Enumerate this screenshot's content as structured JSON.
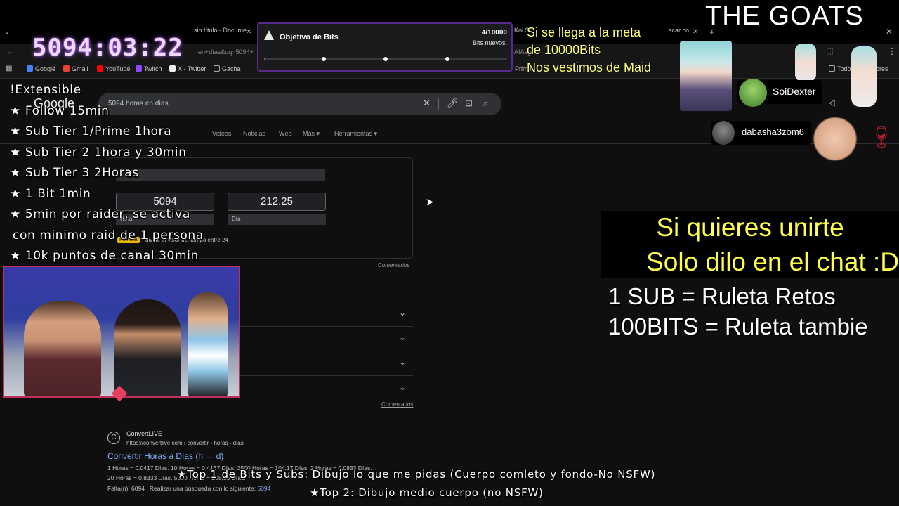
{
  "browser": {
    "tabs": [
      "sin título - Docume",
      "Objetivo de Bits"
    ],
    "tab_partials": [
      "Koi S",
      "scar co"
    ],
    "url": "en+días&oq=5094+",
    "url_right": "AIAsg",
    "bookmarks": [
      {
        "label": "Google",
        "color": "#4285f4"
      },
      {
        "label": "Gmail",
        "color": "#ea4335"
      },
      {
        "label": "YouTube",
        "color": "#ff0000"
      },
      {
        "label": "Twitch",
        "color": "#9146ff"
      },
      {
        "label": "X - Twitter",
        "color": "#ffffff"
      },
      {
        "label": "Gacha",
        "color": "#8a8a8a"
      }
    ],
    "bookmarks_right": [
      "Prime",
      "Todo",
      "dores"
    ]
  },
  "google": {
    "logo": "Google",
    "query": "5094 horas en días",
    "tabs": [
      "Videos",
      "Noticias",
      "Web",
      "Más ▾",
      "Herramientas ▾"
    ],
    "converter": {
      "left_value": "5094",
      "right_value": "212.25",
      "equals": "=",
      "left_unit": "Hora",
      "right_unit": "Día",
      "formula_badge": "Fórmula",
      "formula_text": "divide el valor de tiempo entre 24",
      "comentarios": "Comentarios"
    },
    "comentarios_2": "Comentarios",
    "result": {
      "site": "ConvertLIVE",
      "url": "https://convertlive.com › convertir › horas › días",
      "title": "Convertir Horas a Días (h → d)",
      "line1": "1 Horas = 0.0417 Días. 10 Horas = 0.4167 Días. 2500 Horas = 104.17 Días. 2 Horas = 0.0833 Días.",
      "line2": "20 Horas = 0.8333 Días. 5000 Horas = 208.33 Días.",
      "line3_prefix": "Falta(n): 6094 | Realizar una búsqueda con lo siguiente:",
      "line3_link": "5094"
    }
  },
  "overlay": {
    "timer": "5094:03:22",
    "bits_goal": {
      "title": "Objetivo de Bits",
      "count": "4/10000",
      "subtitle": "Bits nuevos.",
      "progress": 0.0004
    },
    "maid_text": [
      "Si se llega a la meta",
      "de 10000Bits",
      "Nos vestimos de Maid"
    ],
    "brand": "THE GOATS",
    "rules": [
      "!Extensible",
      "★ Follow 15min",
      "★ Sub Tier 1/Prime 1hora",
      "★ Sub Tier 2 1hora y 30min",
      "★ Sub Tier 3 2Horas",
      "★ 1 Bit 1min",
      "★ 5min por raider, se activa",
      "con minimo raid de 1 persona",
      "★ 10k puntos de canal 30min"
    ],
    "join": [
      "Si quieres unirte",
      "Solo dilo en el chat :D"
    ],
    "ruleta": [
      "1 SUB = Ruleta Retos",
      "100BITS = Ruleta tambie"
    ],
    "viewers": [
      "SoiDexter",
      "dabasha3zom6"
    ],
    "top": [
      "★Top 1 de Bits y Subs: Dibujo lo que me pidas (Cuerpo comleto y fondo-No NSFW)",
      "★Top 2: Dibujo medio cuerpo (no NSFW)"
    ]
  }
}
